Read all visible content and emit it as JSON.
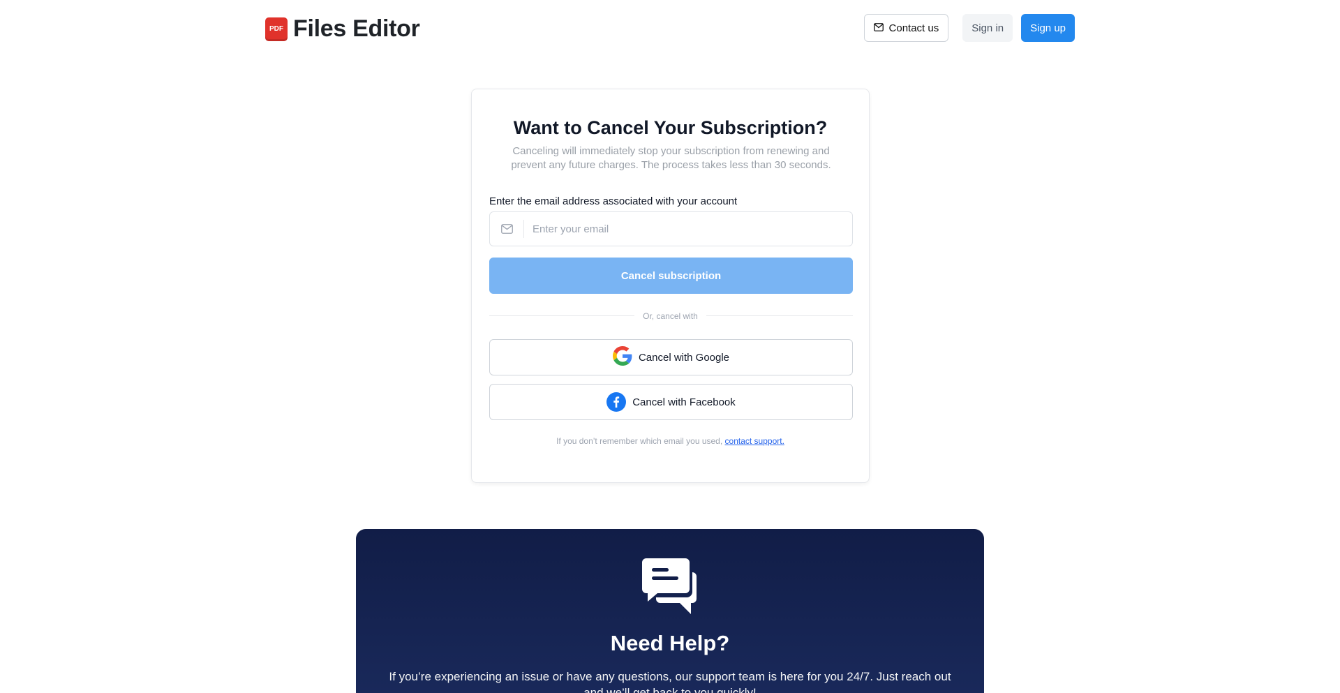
{
  "header": {
    "logo_badge": "PDF",
    "logo_text": "Files Editor",
    "contact_label": "Contact us",
    "signin_label": "Sign in",
    "signup_label": "Sign up"
  },
  "card": {
    "title": "Want to Cancel Your Subscription?",
    "subtitle": "Canceling will immediately stop your subscription from renewing and prevent any future charges. The process takes less than 30 seconds.",
    "email_label": "Enter the email address associated with your account",
    "email_placeholder": "Enter your email",
    "email_value": "",
    "cancel_button": "Cancel subscription",
    "divider_text": "Or, cancel with",
    "google_button": "Cancel with Google",
    "facebook_button": "Cancel with Facebook",
    "footnote_text": "If you don’t remember which email you used,",
    "footnote_link": "contact support."
  },
  "help": {
    "title": "Need Help?",
    "text": "If you’re experiencing an issue or have any questions, our support team is here for you 24/7. Just reach out and we’ll get back to you quickly!"
  },
  "icons": {
    "logo": "pdf-logo-icon",
    "contact": "mail-icon",
    "email_field": "mail-icon",
    "google": "google-icon",
    "facebook": "facebook-icon",
    "help": "chat-bubbles-icon"
  },
  "colors": {
    "primary": "#2388ee",
    "primary_disabled": "#79b4f3",
    "logo_red": "#e0322b",
    "help_bg": "#111d47",
    "link": "#2563eb"
  }
}
